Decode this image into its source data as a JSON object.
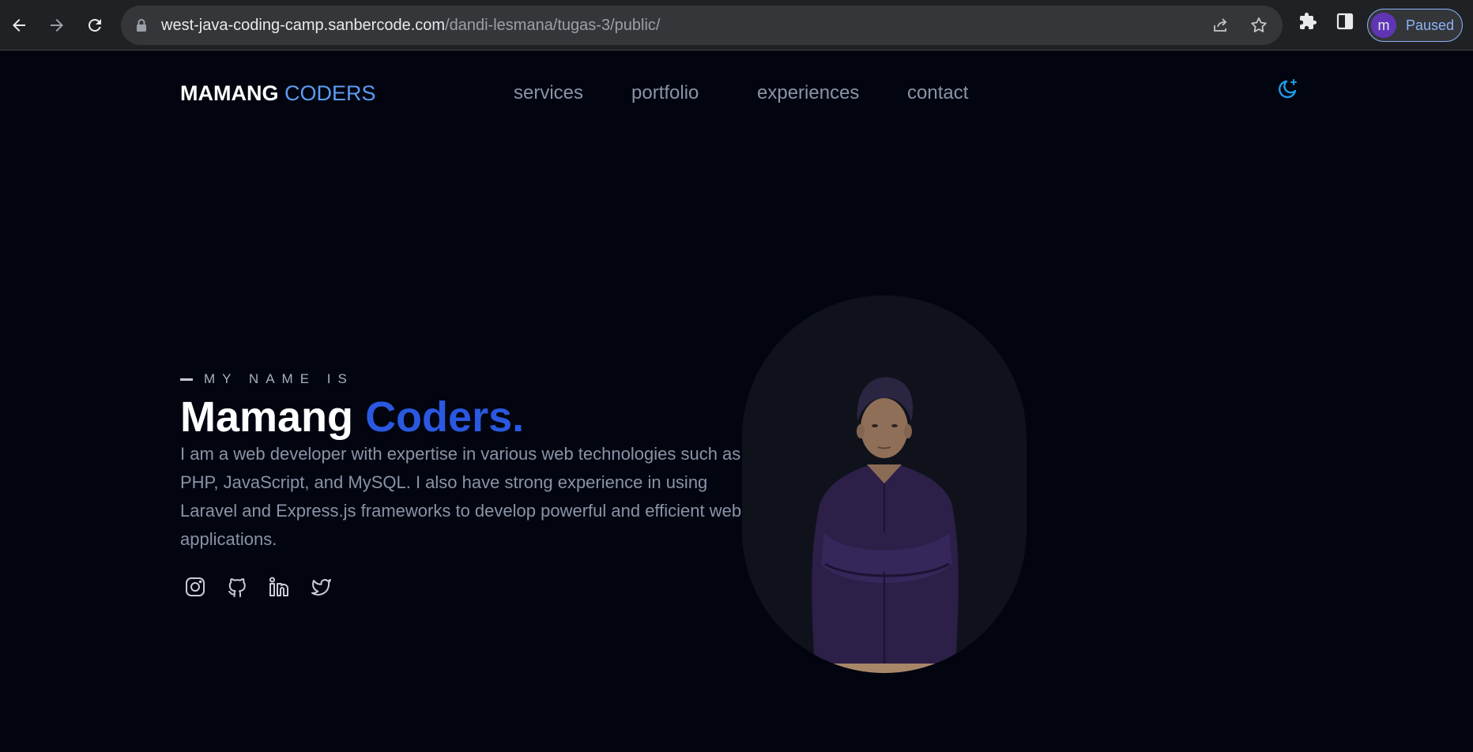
{
  "browser": {
    "url_host": "west-java-coding-camp.sanbercode.com",
    "url_path": "/dandi-lesmana/tugas-3/public/",
    "profile_initial": "m",
    "profile_status": "Paused",
    "icons": [
      "back-icon",
      "forward-icon",
      "reload-icon",
      "lock-icon",
      "share-icon",
      "star-icon",
      "extensions-icon",
      "side-panel-icon"
    ]
  },
  "header": {
    "logo_bold": "MAMANG",
    "logo_accent": "CODERS",
    "nav": [
      {
        "label": "services"
      },
      {
        "label": "portfolio"
      },
      {
        "label": "experiences"
      },
      {
        "label": "contact"
      }
    ],
    "theme_icon": "moon-sparkle-icon"
  },
  "hero": {
    "kicker": "MY NAME IS",
    "name_first": "Mamang",
    "name_accent": "Coders.",
    "bio": "I am a web developer with expertise in various web technologies such as PHP, JavaScript, and MySQL. I also have strong experience in using Laravel and Express.js frameworks to develop powerful and efficient web applications.",
    "socials": [
      "instagram-icon",
      "github-icon",
      "linkedin-icon",
      "twitter-icon"
    ]
  },
  "colors": {
    "page_bg": "#02050f",
    "accent_blue": "#2a58e0",
    "logo_accent": "#5b9cf0",
    "theme_icon": "#1e9be9",
    "muted_text": "#8a93a8"
  }
}
